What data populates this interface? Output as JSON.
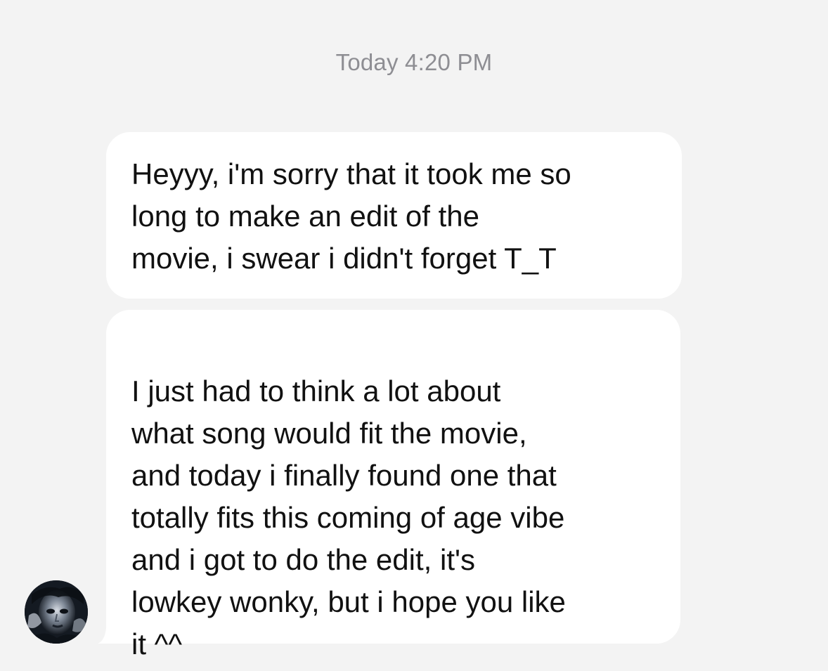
{
  "thread": {
    "timestamp": "Today 4:20 PM",
    "messages": [
      {
        "sender": "other",
        "text": "Heyyy, i'm sorry that it took me so\nlong to make an edit of the\nmovie, i swear i didn't forget T_T"
      },
      {
        "sender": "other",
        "text": "I just had to think a lot about\nwhat song would fit the movie,\nand today i finally found one that\ntotally fits this coming of age vibe\nand i got to do the edit, it's\nlowkey wonky, but i hope you like\nit ^^"
      }
    ]
  },
  "avatar": {
    "icon": "contact-avatar-photo"
  },
  "colors": {
    "background": "#f3f3f3",
    "bubble": "#ffffff",
    "text": "#111111",
    "timestamp": "#8e8e93"
  }
}
